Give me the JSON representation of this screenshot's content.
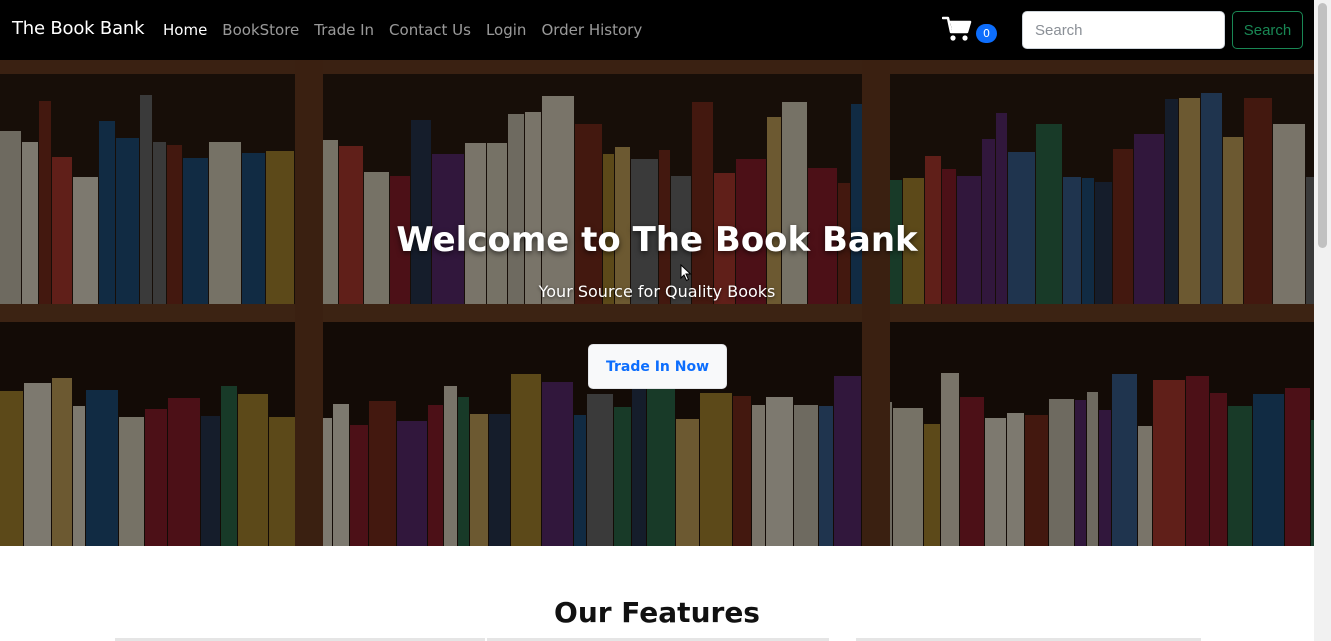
{
  "navbar": {
    "brand": "The Book Bank",
    "links": [
      {
        "label": "Home",
        "active": true
      },
      {
        "label": "BookStore",
        "active": false
      },
      {
        "label": "Trade In",
        "active": false
      },
      {
        "label": "Contact Us",
        "active": false
      },
      {
        "label": "Login",
        "active": false
      },
      {
        "label": "Order History",
        "active": false
      }
    ],
    "cart_icon": "shopping-cart-icon",
    "cart_count": "0",
    "search_placeholder": "Search",
    "search_value": "",
    "search_button": "Search"
  },
  "hero": {
    "title": "Welcome to The Book Bank",
    "subtitle": "Your Source for Quality Books",
    "button": "Trade In Now"
  },
  "features": {
    "title": "Our Features"
  },
  "colors": {
    "navbar_bg": "#000000",
    "badge": "#0d6efd",
    "search_button": "#198754",
    "hero_button_text": "#0d6efd"
  }
}
